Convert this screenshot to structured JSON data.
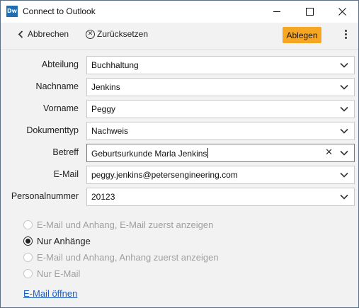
{
  "window": {
    "title": "Connect to Outlook",
    "app_icon_text": "Dw"
  },
  "toolbar": {
    "back_label": "Abbrechen",
    "reset_label": "Zurücksetzen",
    "file_label": "Ablegen",
    "accent_color": "#f5a623"
  },
  "form": {
    "department": {
      "label": "Abteilung",
      "value": "Buchhaltung"
    },
    "last_name": {
      "label": "Nachname",
      "value": "Jenkins"
    },
    "first_name": {
      "label": "Vorname",
      "value": "Peggy"
    },
    "doc_type": {
      "label": "Dokumenttyp",
      "value": "Nachweis"
    },
    "subject": {
      "label": "Betreff",
      "value": "Geburtsurkunde Marla Jenkins"
    },
    "email": {
      "label": "E-Mail",
      "value": "peggy.jenkins@petersengineering.com"
    },
    "personnel_number": {
      "label": "Personalnummer",
      "value": "20123"
    }
  },
  "options": [
    {
      "label": "E-Mail und Anhang, E-Mail zuerst anzeigen",
      "selected": false,
      "enabled": false
    },
    {
      "label": "Nur Anhänge",
      "selected": true,
      "enabled": true
    },
    {
      "label": "E-Mail und Anhang, Anhang zuerst anzeigen",
      "selected": false,
      "enabled": false
    },
    {
      "label": "Nur E-Mail",
      "selected": false,
      "enabled": false
    }
  ],
  "link": {
    "open_email": "E-Mail öffnen"
  }
}
